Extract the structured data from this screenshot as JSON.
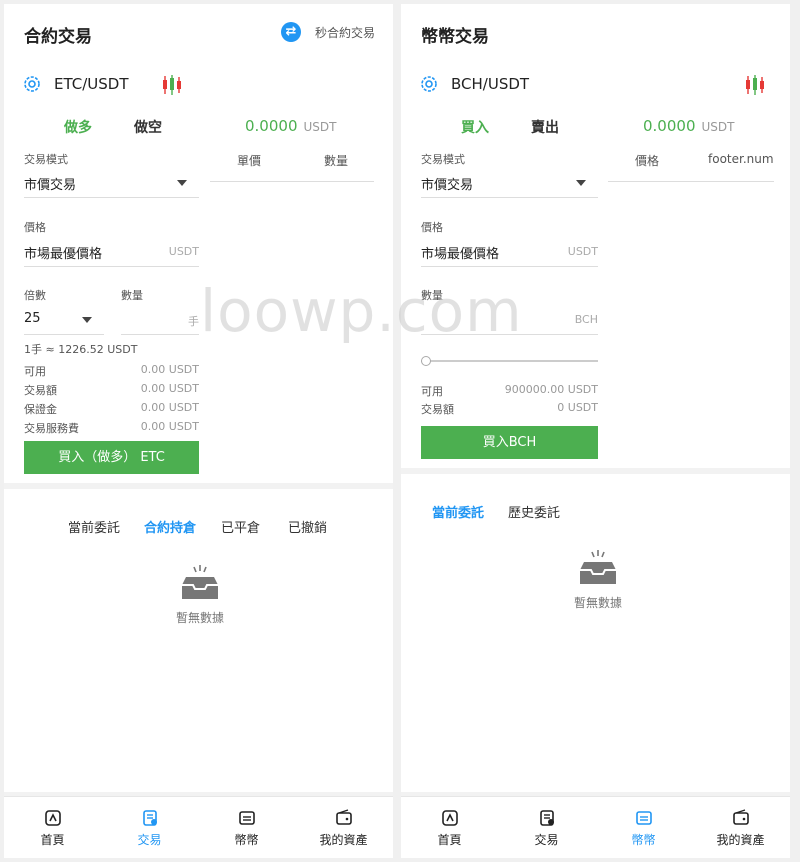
{
  "left": {
    "title": "合約交易",
    "switch_label": "秒合約交易",
    "pair": "ETC/USDT",
    "tabs": {
      "long": "做多",
      "short": "做空"
    },
    "price": "0.0000",
    "price_unit": "USDT",
    "mode_label": "交易模式",
    "mode_value": "市價交易",
    "price_label": "價格",
    "price_value": "市場最優價格",
    "price_field_unit": "USDT",
    "leverage_label": "倍數",
    "leverage_value": "25",
    "qty_label": "數量",
    "qty_unit": "手",
    "lot_note": "1手 ≈ 1226.52 USDT",
    "info": [
      {
        "label": "可用",
        "value": "0.00 USDT"
      },
      {
        "label": "交易額",
        "value": "0.00 USDT"
      },
      {
        "label": "保證金",
        "value": "0.00 USDT"
      },
      {
        "label": "交易服務費",
        "value": "0.00 USDT"
      }
    ],
    "buy_button": "買入（做多） ETC",
    "book_headers": {
      "price": "單價",
      "qty": "數量"
    },
    "order_tabs": [
      "當前委託",
      "合約持倉",
      "已平倉",
      "已撤銷"
    ],
    "active_order_tab": 1,
    "empty_text": "暫無數據"
  },
  "right": {
    "title": "幣幣交易",
    "pair": "BCH/USDT",
    "tabs": {
      "buy": "買入",
      "sell": "賣出"
    },
    "price": "0.0000",
    "price_unit": "USDT",
    "mode_label": "交易模式",
    "mode_value": "市價交易",
    "price_label": "價格",
    "price_value": "市場最優價格",
    "price_field_unit": "USDT",
    "qty_label": "數量",
    "qty_unit": "BCH",
    "slider_level": 0,
    "info": [
      {
        "label": "可用",
        "value": "900000.00 USDT"
      },
      {
        "label": "交易額",
        "value": "0 USDT"
      }
    ],
    "buy_button": "買入BCH",
    "book_headers": {
      "price": "價格",
      "qty": "footer.num"
    },
    "order_tabs": [
      "當前委託",
      "歷史委託"
    ],
    "active_order_tab": 0,
    "empty_text": "暫無數據"
  },
  "nav_left": {
    "items": [
      "首頁",
      "交易",
      "幣幣",
      "我的資產"
    ],
    "active": 1
  },
  "nav_right": {
    "items": [
      "首頁",
      "交易",
      "幣幣",
      "我的資產"
    ],
    "active": 2
  },
  "watermark": "loowp.com",
  "colors": {
    "accent_green": "#4caf50",
    "accent_blue": "#2196f3"
  }
}
